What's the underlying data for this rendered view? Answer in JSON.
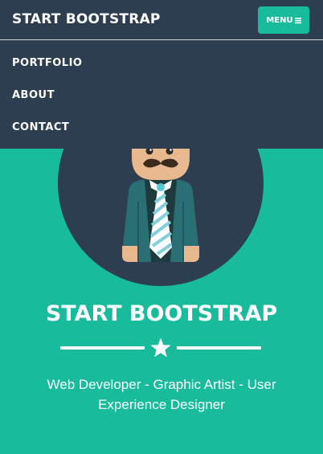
{
  "navbar": {
    "brand": "START BOOTSTRAP",
    "menu_label": "MENU",
    "menu_icon": "bars-icon",
    "items": [
      {
        "label": "PORTFOLIO"
      },
      {
        "label": "ABOUT"
      },
      {
        "label": "CONTACT"
      }
    ]
  },
  "hero": {
    "avatar_icon": "developer-avatar-icon",
    "title": "START BOOTSTRAP",
    "divider_icon": "star-icon",
    "skills": "Web Developer - Graphic Artist - User Experience Designer"
  },
  "colors": {
    "primary": "#2c3e50",
    "accent": "#18bc9c",
    "text": "#ffffff"
  }
}
